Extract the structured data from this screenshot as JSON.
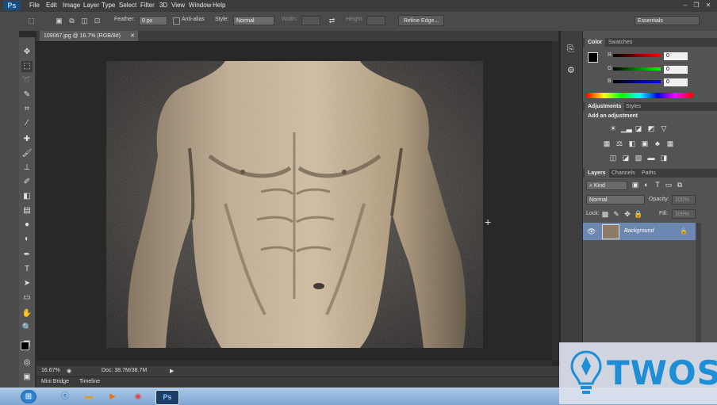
{
  "menubar": {
    "logo": "Ps",
    "items": [
      "File",
      "Edit",
      "Image",
      "Layer",
      "Type",
      "Select",
      "Filter",
      "3D",
      "View",
      "Window",
      "Help"
    ]
  },
  "options": {
    "feather_label": "Feather:",
    "feather_value": "0 px",
    "antialias_label": "Anti-alias",
    "style_label": "Style:",
    "style_value": "Normal",
    "width_label": "Width:",
    "height_label": "Height:",
    "refine_edge": "Refine Edge...",
    "workspace": "Essentials"
  },
  "document": {
    "tab_title": "109067.jpg @ 16.7% (RGB/8#)",
    "zoom": "16.67%",
    "doc_size": "Doc: 38.7M/38.7M"
  },
  "bottom_tabs": [
    "Mini Bridge",
    "Timeline"
  ],
  "color_panel": {
    "tabs": [
      "Color",
      "Swatches"
    ],
    "channels": [
      {
        "label": "R",
        "value": "0",
        "color": "#ff0000"
      },
      {
        "label": "G",
        "value": "0",
        "color": "#00ff00"
      },
      {
        "label": "B",
        "value": "0",
        "color": "#0000ff"
      }
    ]
  },
  "adjustments_panel": {
    "tabs": [
      "Adjustments",
      "Styles"
    ],
    "heading": "Add an adjustment"
  },
  "layers_panel": {
    "tabs": [
      "Layers",
      "Channels",
      "Paths"
    ],
    "filter": "Kind",
    "blend_mode": "Normal",
    "opacity_label": "Opacity:",
    "opacity_value": "100%",
    "lock_label": "Lock:",
    "fill_label": "Fill:",
    "fill_value": "100%",
    "layer_name": "Background"
  },
  "watermark": {
    "text": "TWOS",
    "accent": "#1e8fd6"
  }
}
